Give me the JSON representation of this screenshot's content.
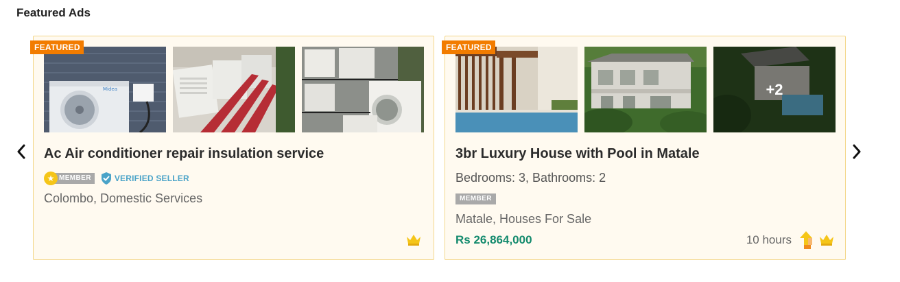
{
  "section": {
    "title": "Featured Ads"
  },
  "icons": {
    "prev": "chevron-left-icon",
    "next": "chevron-right-icon",
    "star": "star-icon",
    "verified": "verified-shield-icon",
    "crown": "crown-icon",
    "bump": "bump-up-icon"
  },
  "colors": {
    "featured_badge": "#f27c00",
    "card_bg": "#fffaf0",
    "card_border": "#f3d78a",
    "price": "#138a6d",
    "verified": "#4aa3c8",
    "member_chip": "#a9a9a9",
    "crown": "#f5c518"
  },
  "ads": [
    {
      "badge": "FEATURED",
      "title": "Ac Air conditioner repair insulation service",
      "member_label": "MEMBER",
      "verified_label": "VERIFIED SELLER",
      "location": "Colombo, Domestic Services"
    },
    {
      "badge": "FEATURED",
      "title": "3br Luxury House with Pool in Matale",
      "details": "Bedrooms: 3, Bathrooms: 2",
      "member_label": "MEMBER",
      "location": "Matale, Houses For Sale",
      "price": "Rs 26,864,000",
      "time": "10 hours",
      "more_photos": "+2"
    }
  ]
}
